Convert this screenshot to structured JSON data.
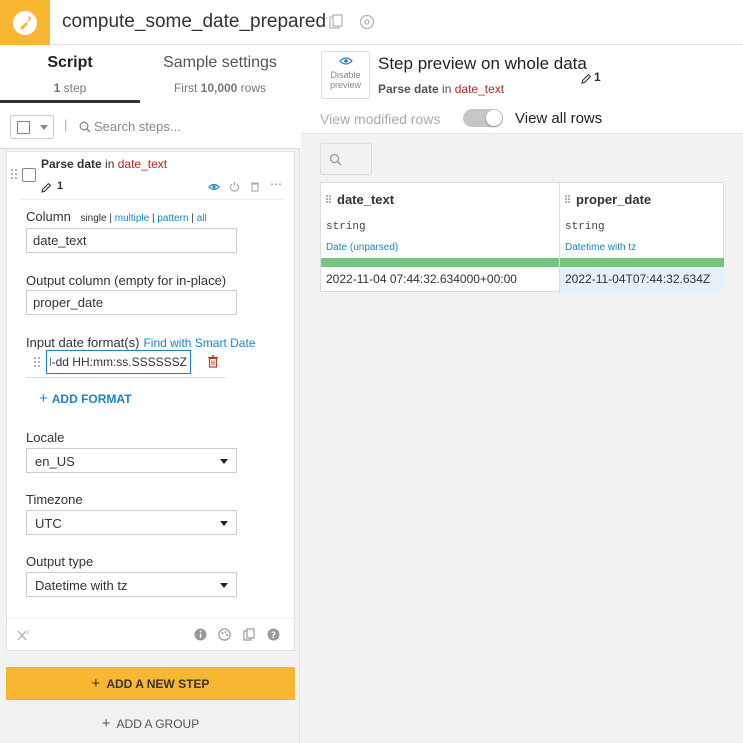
{
  "header": {
    "recipe_title": "compute_some_date_prepared",
    "accent_color": "#f7b731"
  },
  "left_tabs": {
    "script_label": "Script",
    "script_sub_count": "1",
    "script_sub_text": " step",
    "sample_label": "Sample settings",
    "sample_sub_prefix": "First ",
    "sample_sub_count": "10,000",
    "sample_sub_suffix": " rows"
  },
  "search": {
    "placeholder": "Search steps..."
  },
  "step": {
    "title": "Parse date",
    "in_text": " in ",
    "column_ref": "date_text",
    "count": "1",
    "icons": [
      "eye-icon",
      "power-icon",
      "trash-icon",
      "ellipsis-icon"
    ]
  },
  "form": {
    "column_label": "Column",
    "column_modes": {
      "single": "single",
      "multiple": "multiple",
      "pattern": "pattern",
      "all": "all",
      "separator": "|"
    },
    "column_value": "date_text",
    "output_label": "Output column (empty for in-place)",
    "output_value": "proper_date",
    "formats_label": "Input date format(s)",
    "smart_date_link": "Find with Smart Date",
    "format_value": "yyyy-MM-dd HH:mm:ss.SSSSSSZ",
    "add_format": "ADD FORMAT",
    "locale_label": "Locale",
    "locale_value": "en_US",
    "timezone_label": "Timezone",
    "timezone_value": "UTC",
    "output_type_label": "Output type",
    "output_type_value": "Datetime with tz"
  },
  "buttons": {
    "add_step": "ADD A NEW STEP",
    "add_group": "ADD A GROUP"
  },
  "preview": {
    "disable_line1": "Disable",
    "disable_line2": "preview",
    "title": "Step preview on whole data",
    "sub_step": "Parse date",
    "sub_in": " in ",
    "sub_column": "date_text",
    "count": "1",
    "view_modified": "View modified rows",
    "view_all": "View all rows"
  },
  "table": {
    "columns": [
      {
        "name": "date_text",
        "type": "string",
        "meaning": "Date (unparsed)"
      },
      {
        "name": "proper_date",
        "type": "string",
        "meaning": "Datetime with tz"
      }
    ],
    "rows": [
      [
        "2022-11-04 07:44:32.634000+00:00",
        "2022-11-04T07:44:32.634Z"
      ]
    ],
    "bar_color": "#7bc47f",
    "valid_fraction": 1.0
  }
}
